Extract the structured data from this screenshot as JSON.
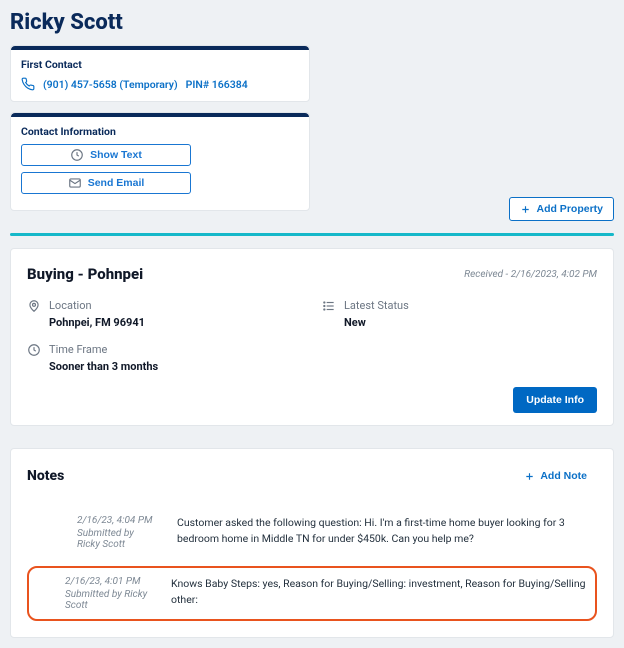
{
  "title": "Ricky Scott",
  "first_contact": {
    "heading": "First Contact",
    "phone": "(901) 457-5658 (Temporary)",
    "pin": "PIN# 166384"
  },
  "contact_info": {
    "heading": "Contact Information",
    "show_text": "Show Text",
    "send_email": "Send Email"
  },
  "add_property": "Add Property",
  "lead": {
    "title": "Buying - Pohnpei",
    "received": "Received - 2/16/2023, 4:02 PM",
    "location_label": "Location",
    "location_value": "Pohnpei, FM 96941",
    "status_label": "Latest Status",
    "status_value": "New",
    "timeframe_label": "Time Frame",
    "timeframe_value": "Sooner than 3 months",
    "update": "Update Info"
  },
  "notes": {
    "title": "Notes",
    "add": "Add Note",
    "items": [
      {
        "ts": "2/16/23, 4:04 PM",
        "by": "Submitted by Ricky Scott",
        "body": "Customer asked the following question: Hi. I'm a first-time home buyer looking for 3 bedroom home in Middle TN for under $450k. Can you help me?"
      },
      {
        "ts": "2/16/23, 4:01 PM",
        "by": "Submitted by Ricky Scott",
        "body": "Knows Baby Steps: yes, Reason for Buying/Selling: investment, Reason for Buying/Selling other:"
      }
    ]
  }
}
